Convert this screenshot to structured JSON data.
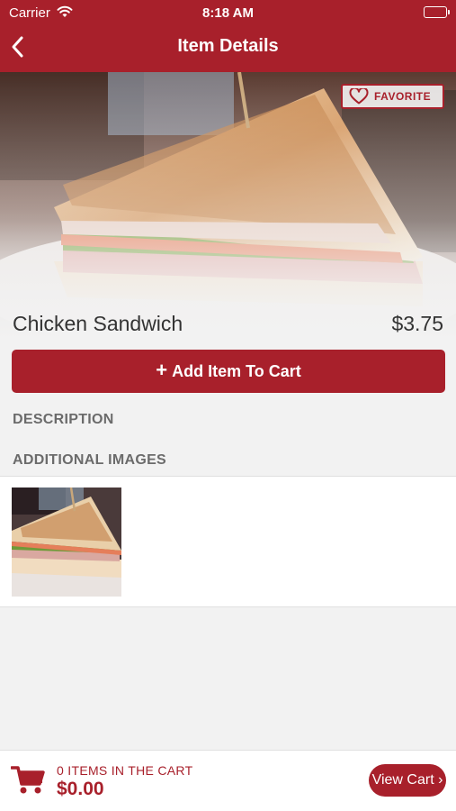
{
  "status_bar": {
    "carrier": "Carrier",
    "time": "8:18 AM",
    "battery_level": 1.0
  },
  "header": {
    "title": "Item Details",
    "back_icon": "chevron-left-icon"
  },
  "item": {
    "name": "Chicken Sandwich",
    "price": "$3.75",
    "favorite_label": "FAVORITE",
    "favorite_icon": "heart-outline-icon"
  },
  "actions": {
    "add_to_cart_label": "Add Item To Cart",
    "add_icon": "plus-icon"
  },
  "sections": {
    "description_label": "DESCRIPTION",
    "additional_images_label": "ADDITIONAL IMAGES"
  },
  "cart": {
    "items_label": "0 ITEMS IN THE CART",
    "total": "$0.00",
    "view_cart_label": "View Cart ›",
    "cart_icon": "shopping-cart-icon"
  },
  "colors": {
    "brand": "#a8202b",
    "background": "#f2f2f2",
    "label_gray": "#6b6b6b"
  }
}
